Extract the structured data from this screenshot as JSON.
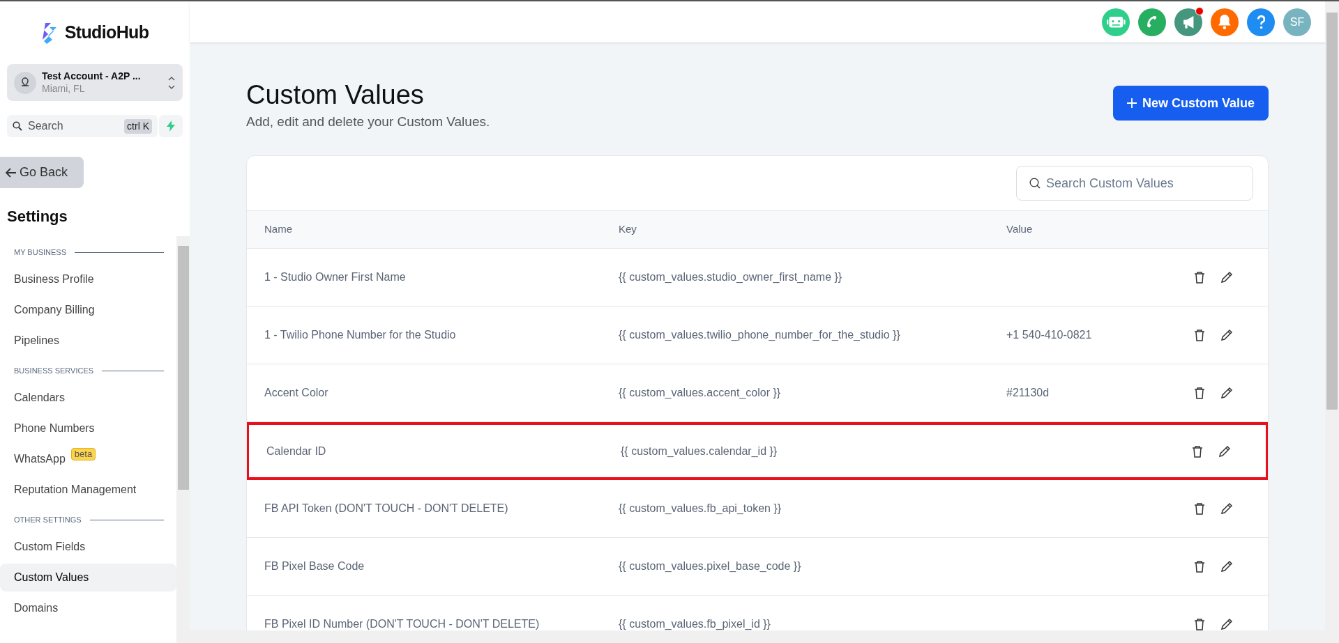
{
  "brand": {
    "name": "StudioHub"
  },
  "account": {
    "name": "Test Account - A2P ...",
    "location": "Miami, FL"
  },
  "search": {
    "placeholder": "Search",
    "shortcut": "ctrl K"
  },
  "back_button": "Go Back",
  "sidebar": {
    "title": "Settings",
    "sections": [
      {
        "heading": "MY BUSINESS",
        "items": [
          {
            "label": "Business Profile",
            "selected": false
          },
          {
            "label": "Company Billing",
            "selected": false
          },
          {
            "label": "Pipelines",
            "selected": false
          }
        ]
      },
      {
        "heading": "BUSINESS SERVICES",
        "items": [
          {
            "label": "Calendars",
            "selected": false
          },
          {
            "label": "Phone Numbers",
            "selected": false
          },
          {
            "label": "WhatsApp",
            "badge": "beta",
            "selected": false
          },
          {
            "label": "Reputation Management",
            "selected": false
          }
        ]
      },
      {
        "heading": "OTHER SETTINGS",
        "items": [
          {
            "label": "Custom Fields",
            "selected": false
          },
          {
            "label": "Custom Values",
            "selected": true
          },
          {
            "label": "Domains",
            "selected": false
          }
        ]
      }
    ]
  },
  "header": {
    "actions": [
      {
        "kind": "bot",
        "color": "#2ecf8a",
        "dot": false
      },
      {
        "kind": "phone",
        "color": "#27ae60",
        "dot": false
      },
      {
        "kind": "megaphone",
        "color": "#44967e",
        "dot": true
      },
      {
        "kind": "bell",
        "color": "#ff6a00",
        "dot": false
      },
      {
        "kind": "help",
        "color": "#1e8cf0",
        "dot": false
      }
    ],
    "avatar": "SF"
  },
  "page": {
    "title": "Custom Values",
    "subtitle": "Add, edit and delete your Custom Values.",
    "new_button": "New Custom Value"
  },
  "table": {
    "search_placeholder": "Search Custom Values",
    "columns": [
      "Name",
      "Key",
      "Value"
    ],
    "rows": [
      {
        "name": "1 - Studio Owner First Name",
        "key": "{{ custom_values.studio_owner_first_name }}",
        "highlighted": false
      },
      {
        "name": "1 - Twilio Phone Number for the Studio",
        "key": "{{ custom_values.twilio_phone_number_for_the_studio }}",
        "value": "+1 540-410-0821",
        "highlighted": false
      },
      {
        "name": "Accent Color",
        "key": "{{ custom_values.accent_color }}",
        "value": "#21130d",
        "highlighted": false
      },
      {
        "name": "Calendar ID",
        "key": "{{ custom_values.calendar_id }}",
        "highlighted": true
      },
      {
        "name": "FB API Token (DON'T TOUCH - DON'T DELETE)",
        "key": "{{ custom_values.fb_api_token }}",
        "highlighted": false
      },
      {
        "name": "FB Pixel Base Code",
        "key": "{{ custom_values.pixel_base_code }}",
        "highlighted": false
      },
      {
        "name": "FB Pixel ID Number (DON'T TOUCH - DON'T DELETE)",
        "key": "{{ custom_values.fb_pixel_id }}",
        "highlighted": false
      }
    ]
  }
}
